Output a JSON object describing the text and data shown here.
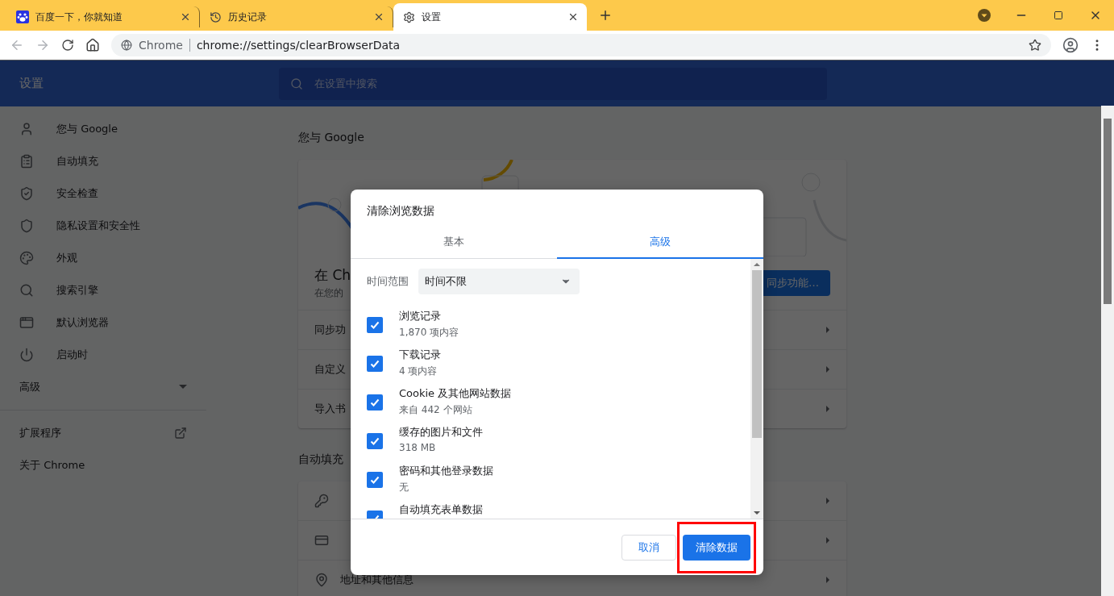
{
  "tabs": [
    {
      "title": "百度一下，你就知道",
      "kind": "baidu",
      "selected": false
    },
    {
      "title": "历史记录",
      "kind": "history",
      "selected": false
    },
    {
      "title": "设置",
      "kind": "settings",
      "selected": true
    }
  ],
  "toolbar": {
    "site_label": "Chrome",
    "url": "chrome://settings/clearBrowserData"
  },
  "header": {
    "title": "设置",
    "search": {
      "placeholder": "在设置中搜索"
    }
  },
  "sidebar": {
    "items": [
      {
        "label": "您与 Google",
        "kind": "person"
      },
      {
        "label": "自动填充",
        "kind": "clipboard"
      },
      {
        "label": "安全检查",
        "kind": "shield-check"
      },
      {
        "label": "隐私设置和安全性",
        "kind": "shield"
      },
      {
        "label": "外观",
        "kind": "palette"
      },
      {
        "label": "搜索引擎",
        "kind": "search"
      },
      {
        "label": "默认浏览器",
        "kind": "browser"
      },
      {
        "label": "启动时",
        "kind": "power"
      }
    ],
    "advanced": {
      "label": "高级",
      "expanded": false
    },
    "extensions": "扩展程序",
    "about": "关于 Chrome"
  },
  "main": {
    "section_title": "您与 Google",
    "sync_card": {
      "heading": "在 Ch",
      "subtext": "在您的",
      "button": "同步功能…",
      "rows": [
        "同步功",
        "自定义",
        "导入书"
      ]
    },
    "autofill": {
      "title": "自动填充",
      "rows": [
        {
          "kind": "key"
        },
        {
          "kind": "card"
        },
        {
          "kind": "pin",
          "label": "地址和其他信息"
        }
      ]
    }
  },
  "dialog": {
    "title": "清除浏览数据",
    "tabs": [
      {
        "label": "基本",
        "selected": false
      },
      {
        "label": "高级",
        "selected": true
      }
    ],
    "time_range": {
      "label": "时间范围",
      "value": "时间不限"
    },
    "items": [
      {
        "label": "浏览记录",
        "detail": "1,870 项内容",
        "checked": true
      },
      {
        "label": "下载记录",
        "detail": "4 项内容",
        "checked": true
      },
      {
        "label": "Cookie 及其他网站数据",
        "detail": "来自 442 个网站",
        "checked": true
      },
      {
        "label": "缓存的图片和文件",
        "detail": "318 MB",
        "checked": true
      },
      {
        "label": "密码和其他登录数据",
        "detail": "无",
        "checked": true
      },
      {
        "label": "自动填充表单数据",
        "checked": true
      }
    ],
    "cancel": "取消",
    "confirm": "清除数据"
  }
}
